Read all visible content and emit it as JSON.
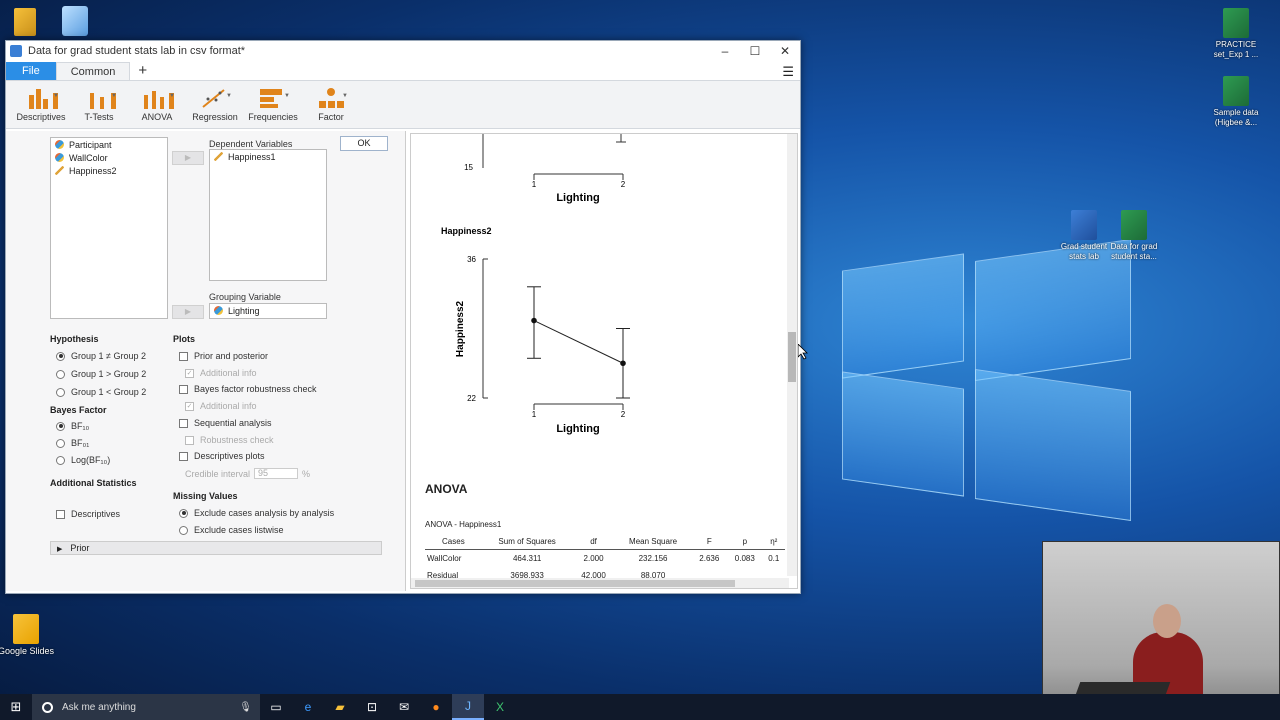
{
  "window": {
    "title": "Data for grad student stats lab in csv format*",
    "min": "–",
    "max": "☐",
    "close": "✕"
  },
  "ribbon": {
    "tabs": [
      {
        "label": "File"
      },
      {
        "label": "Common"
      },
      {
        "label": "+"
      }
    ],
    "menu": "☰"
  },
  "toolbar": {
    "items": [
      {
        "label": "Descriptives"
      },
      {
        "label": "T-Tests"
      },
      {
        "label": "ANOVA"
      },
      {
        "label": "Regression"
      },
      {
        "label": "Frequencies"
      },
      {
        "label": "Factor"
      }
    ]
  },
  "analysis": {
    "variables": [
      {
        "name": "Participant",
        "type": "nominal"
      },
      {
        "name": "WallColor",
        "type": "nominal"
      },
      {
        "name": "Happiness2",
        "type": "scale"
      }
    ],
    "move_arrow": "▶",
    "dependent_label": "Dependent Variables",
    "dependent": [
      "Happiness1"
    ],
    "grouping_label": "Grouping Variable",
    "grouping": "Lighting",
    "ok_label": "OK",
    "hypothesis": {
      "title": "Hypothesis",
      "options": [
        "Group 1 ≠ Group 2",
        "Group 1 > Group 2",
        "Group 1 < Group 2"
      ]
    },
    "bayes_factor": {
      "title": "Bayes Factor",
      "options": [
        "BF₁₀",
        "BF₀₁",
        "Log(BF₁₀)"
      ]
    },
    "additional": {
      "title": "Additional Statistics",
      "descriptives": "Descriptives"
    },
    "plots": {
      "title": "Plots",
      "prior_posterior": "Prior and posterior",
      "additional_info": "Additional info",
      "robustness": "Bayes factor robustness check",
      "sequential": "Sequential analysis",
      "robustness_sub": "Robustness check",
      "descriptives_plots": "Descriptives plots",
      "credible_interval": "Credible interval",
      "credible_value": "95",
      "percent": "%"
    },
    "missing": {
      "title": "Missing Values",
      "options": [
        "Exclude cases analysis by analysis",
        "Exclude cases listwise"
      ]
    },
    "prior_label": "Prior",
    "prior_arrow": "▶"
  },
  "results": {
    "plot1": {
      "y_tick_bottom": "15",
      "x_tick_labels": [
        "1",
        "2"
      ],
      "xlabel": "Lighting"
    },
    "plot2": {
      "title": "Happiness2",
      "ylabel": "Happiness2",
      "y_tick_top": "36",
      "y_tick_bottom": "22",
      "x_tick_labels": [
        "1",
        "2"
      ],
      "xlabel": "Lighting"
    },
    "anova": {
      "section_title": "ANOVA",
      "table_title": "ANOVA - Happiness1",
      "columns": [
        "Cases",
        "Sum of Squares",
        "df",
        "Mean Square",
        "F",
        "p",
        "η²"
      ],
      "rows": [
        [
          "WallColor",
          "464.311",
          "2.000",
          "232.156",
          "2.636",
          "0.083",
          "0.1"
        ],
        [
          "Residual",
          "3698.933",
          "42.000",
          "88.070",
          "",
          "",
          ""
        ]
      ]
    }
  },
  "chart_data": {
    "type": "line",
    "title": "Happiness2",
    "xlabel": "Lighting",
    "ylabel": "Happiness2",
    "categories": [
      "1",
      "2"
    ],
    "values": [
      29.8,
      25.5
    ],
    "error_upper": [
      33.2,
      29.0
    ],
    "error_lower": [
      26.0,
      22.0
    ],
    "ylim": [
      22,
      36
    ],
    "grid": false
  },
  "desktop": {
    "icons": [
      {
        "label": "PRACTICE set_Exp 1 ..."
      },
      {
        "label": "Sample data (Higbee &..."
      },
      {
        "label": "Grad student stats lab"
      },
      {
        "label": "Data for grad student sta..."
      },
      {
        "label": "Google Slides"
      }
    ]
  },
  "taskbar": {
    "search_placeholder": "Ask me anything",
    "start": "⊞"
  }
}
